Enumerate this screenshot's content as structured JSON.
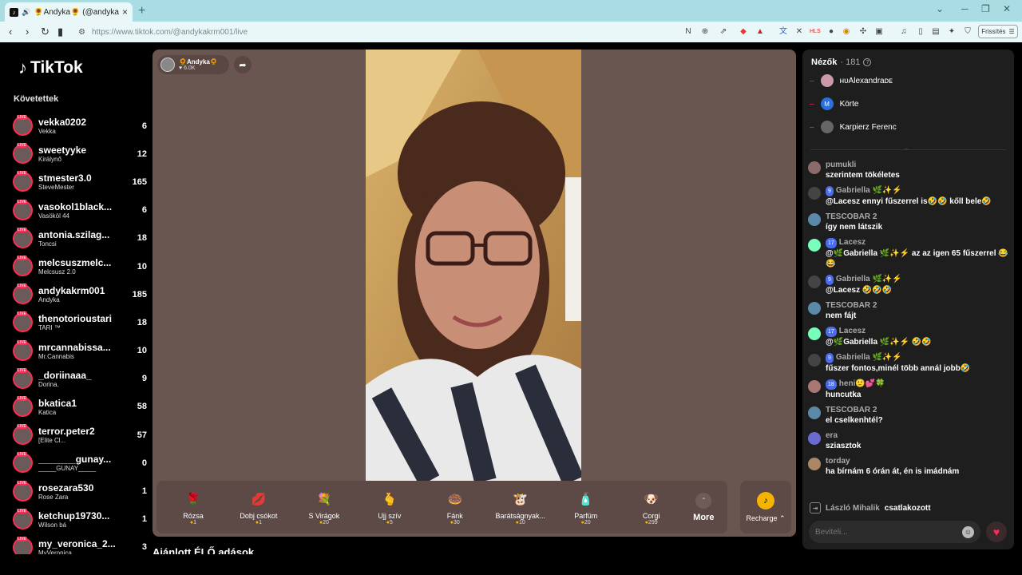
{
  "browser": {
    "tab_title": "🌻Andyka🌻 (@andykakrm001",
    "url": "https://www.tiktok.com/@andykakrm001/live",
    "refresh_label": "Frissítés"
  },
  "sidebar": {
    "logo": "TikTok",
    "section_title": "Követettek",
    "items": [
      {
        "name": "vekka0202",
        "sub": "Vekka",
        "count": "6"
      },
      {
        "name": "sweetyyke",
        "sub": "Királynő",
        "count": "12"
      },
      {
        "name": "stmester3.0",
        "sub": "SteveMester",
        "count": "165"
      },
      {
        "name": "vasokol1black...",
        "sub": "Vasököl 44",
        "count": "6"
      },
      {
        "name": "antonia.szilag...",
        "sub": "Toncsi",
        "count": "18"
      },
      {
        "name": "melcsuszmelc...",
        "sub": "Melcsusz 2.0",
        "count": "10"
      },
      {
        "name": "andykakrm001",
        "sub": "Andyka",
        "count": "185"
      },
      {
        "name": "thenotorioustari",
        "sub": "TARI ™",
        "count": "18"
      },
      {
        "name": "mrcannabissa...",
        "sub": "Mr.Cannabis",
        "count": "10"
      },
      {
        "name": "_doriinaaa_",
        "sub": "Dorina.",
        "count": "9"
      },
      {
        "name": "bkatica1",
        "sub": "Katica",
        "count": "58"
      },
      {
        "name": "terror.peter2",
        "sub": "[Elite Cl...",
        "count": "57"
      },
      {
        "name": "_______gunay...",
        "sub": "_____GUNAY_____",
        "count": "0"
      },
      {
        "name": "rosezara530",
        "sub": "Rose Zara",
        "count": "1"
      },
      {
        "name": "ketchup19730...",
        "sub": "Wilson bá",
        "count": "1"
      },
      {
        "name": "my_veronica_2...",
        "sub": "MyVeronica",
        "count": "3"
      }
    ]
  },
  "stream": {
    "host_name": "🌻Andyka🌻",
    "host_likes": "♥ 6.0K",
    "recommend_title": "Ajánlott ÉLŐ adások"
  },
  "gifts": [
    {
      "name": "Rózsa",
      "price": "1",
      "icon": "🌹",
      "color": "#e8324a"
    },
    {
      "name": "Dobj csókot",
      "price": "1",
      "icon": "💋",
      "color": "#e8324a"
    },
    {
      "name": "S Virágok",
      "price": "20",
      "icon": "💐",
      "color": "#c33"
    },
    {
      "name": "Ujj szív",
      "price": "5",
      "icon": "🫰",
      "color": "#f5a"
    },
    {
      "name": "Fánk",
      "price": "30",
      "icon": "🍩",
      "color": "#f8a"
    },
    {
      "name": "Barátságnyak...",
      "price": "10",
      "icon": "🐮",
      "color": "#a55"
    },
    {
      "name": "Parfüm",
      "price": "20",
      "icon": "🧴",
      "color": "#e6c"
    },
    {
      "name": "Corgi",
      "price": "299",
      "icon": "🐶",
      "color": "#fab"
    }
  ],
  "gift_controls": {
    "more_label": "More",
    "recharge_label": "Recharge ⌃"
  },
  "chat": {
    "viewers_title": "Nézők",
    "viewers_count": "· 181",
    "top_viewers": [
      {
        "name": "ʜᴜAlexandraᴅᴇ"
      },
      {
        "name": "Körte",
        "initial": "M"
      },
      {
        "name": "Karpierz Ferenc"
      }
    ],
    "messages": [
      {
        "name": "pumukli",
        "badge": "",
        "text": "szerintem tökéletes"
      },
      {
        "name": "Gabriella 🌿✨⚡",
        "badge": "9",
        "text": "@Lacesz ennyi fűszerrel is🤣🤣 kőll bele🤣"
      },
      {
        "name": "TESCOBAR 2",
        "badge": "",
        "text": "így nem látszik"
      },
      {
        "name": "Lacesz",
        "badge": "17",
        "text": "@🌿Gabriella 🌿✨⚡ az az igen 65 fűszerrel 😂😂"
      },
      {
        "name": "Gabriella 🌿✨⚡",
        "badge": "9",
        "text": "@Lacesz 🤣🤣🤣"
      },
      {
        "name": "TESCOBAR 2",
        "badge": "",
        "text": "nem fájt"
      },
      {
        "name": "Lacesz",
        "badge": "17",
        "text": "@🌿Gabriella 🌿✨⚡ 🤣🤣"
      },
      {
        "name": "Gabriella 🌿✨⚡",
        "badge": "9",
        "text": "fűszer fontos,minél több annál jobb🤣"
      },
      {
        "name": "heni🙂💕🍀",
        "badge": "18",
        "text": "huncutka"
      },
      {
        "name": "TESCOBAR 2",
        "badge": "",
        "text": "el cselkenhtél?"
      },
      {
        "name": "era",
        "badge": "",
        "text": "sziasztok"
      },
      {
        "name": "torday",
        "badge": "",
        "text": "ha bírnám 6 órán át, én is imádnám"
      }
    ],
    "joined_name": "László Mihalik",
    "joined_text": "csatlakozott",
    "input_placeholder": "Beviteli..."
  }
}
